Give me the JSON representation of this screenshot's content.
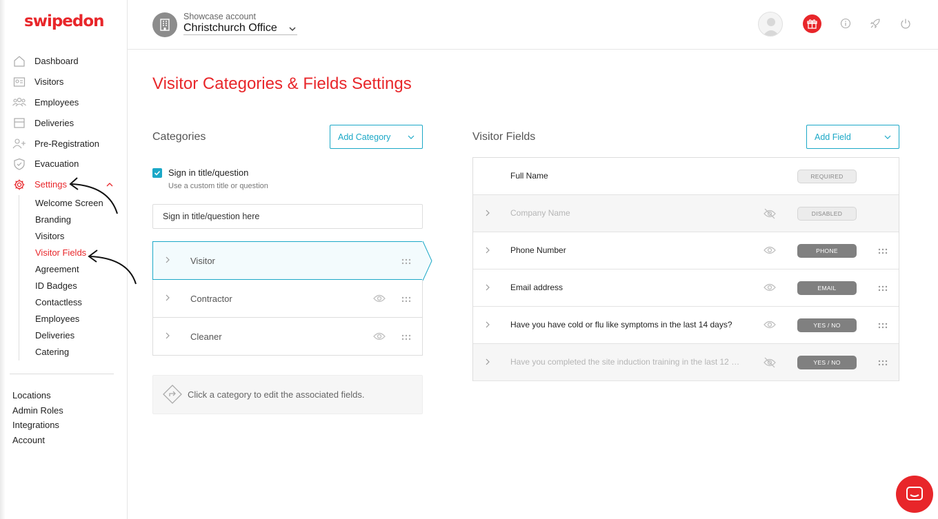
{
  "brand": {
    "logo": "swipedon",
    "accent": "#e8262a",
    "link_color": "#1ba8c7"
  },
  "header": {
    "account_sub": "Showcase account",
    "account_name": "Christchurch Office",
    "icons": [
      "avatar",
      "gift-icon",
      "info-icon",
      "rocket-icon",
      "power-icon"
    ]
  },
  "sidebar": {
    "items": [
      {
        "label": "Dashboard",
        "icon": "home-icon"
      },
      {
        "label": "Visitors",
        "icon": "id-card-icon"
      },
      {
        "label": "Employees",
        "icon": "people-icon"
      },
      {
        "label": "Deliveries",
        "icon": "box-icon"
      },
      {
        "label": "Pre-Registration",
        "icon": "user-plus-icon"
      },
      {
        "label": "Evacuation",
        "icon": "shield-icon"
      },
      {
        "label": "Settings",
        "icon": "gear-icon"
      }
    ],
    "settings_sub": [
      "Welcome Screen",
      "Branding",
      "Visitors",
      "Visitor Fields",
      "Agreement",
      "ID Badges",
      "Contactless",
      "Employees",
      "Deliveries",
      "Catering"
    ],
    "bottom": [
      "Locations",
      "Admin Roles",
      "Integrations",
      "Account"
    ]
  },
  "main": {
    "title": "Visitor Categories & Fields Settings",
    "categories": {
      "heading": "Categories",
      "add_button": "Add Category",
      "checkbox_label": "Sign in title/question",
      "checkbox_checked": true,
      "checkbox_hint": "Use a custom title or question",
      "input_placeholder": "Sign in title/question here",
      "items": [
        "Visitor",
        "Contractor",
        "Cleaner"
      ],
      "selected": "Visitor",
      "hint": "Click a category to edit the associated fields."
    },
    "fields": {
      "heading": "Visitor Fields",
      "add_button": "Add Field",
      "rows": [
        {
          "label": "Full Name",
          "badge": "REQUIRED"
        },
        {
          "label": "Company Name",
          "badge": "DISABLED"
        },
        {
          "label": "Phone Number",
          "badge": "PHONE"
        },
        {
          "label": "Email address",
          "badge": "EMAIL"
        },
        {
          "label": "Have you have cold or flu like symptoms in the last 14 days?",
          "badge": "YES / NO"
        },
        {
          "label": "Have you completed the site induction training in the last 12 mo...",
          "badge": "YES / NO"
        }
      ]
    }
  }
}
